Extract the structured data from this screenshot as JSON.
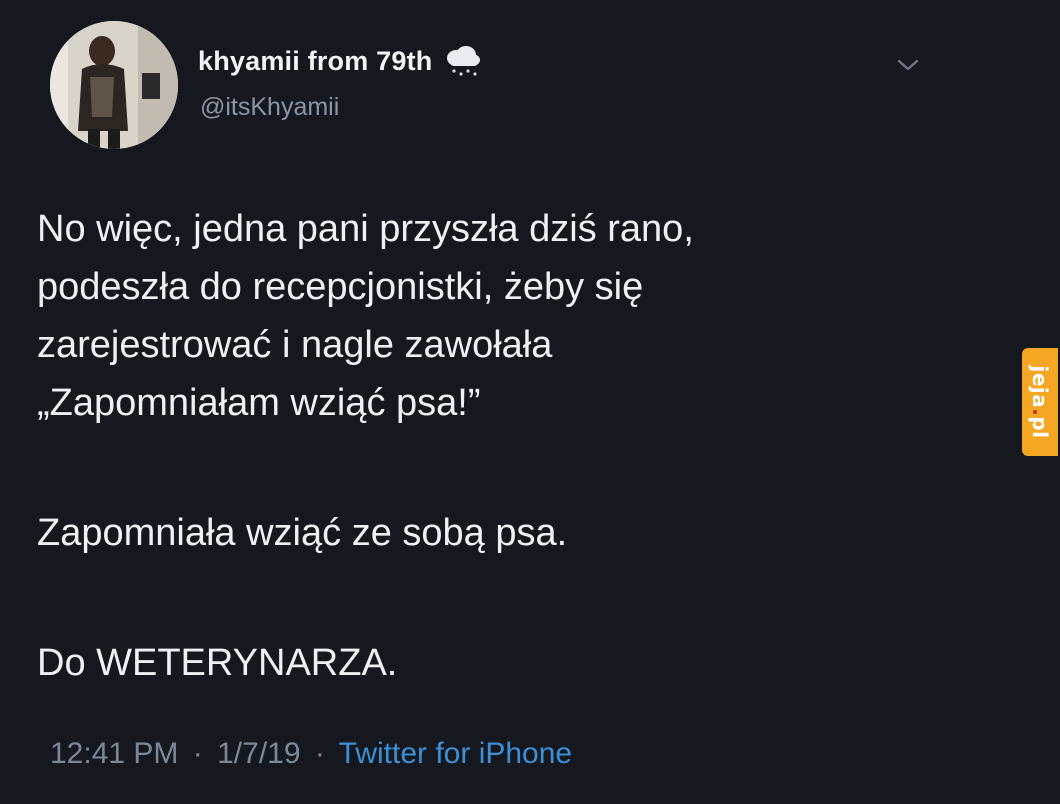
{
  "tweet": {
    "display_name": "khyamii from 79th",
    "handle": "@itsKhyamii",
    "name_icon": "cloud-snow-icon",
    "menu_icon": "chevron-down-icon",
    "paragraphs": {
      "p1": {
        "l1": "No więc, jedna pani przyszła dziś rano,",
        "l2": "podeszła do recepcjonistki, żeby się",
        "l3": "zarejestrować i nagle zawołała",
        "l4": "„Zapomniałam wziąć psa!”"
      },
      "p2": "Zapomniała wziąć ze sobą psa.",
      "p3": "Do WETERYNARZA."
    },
    "time": "12:41 PM",
    "separator": "·",
    "date": "1/7/19",
    "source": "Twitter for iPhone"
  },
  "watermark": {
    "brand": "jeja",
    "tld": "pl"
  },
  "colors": {
    "background": "#15181f",
    "text": "#eef0f3",
    "muted": "#7d8896",
    "link": "#3d8fd6",
    "watermark_bg": "#f5a623"
  }
}
